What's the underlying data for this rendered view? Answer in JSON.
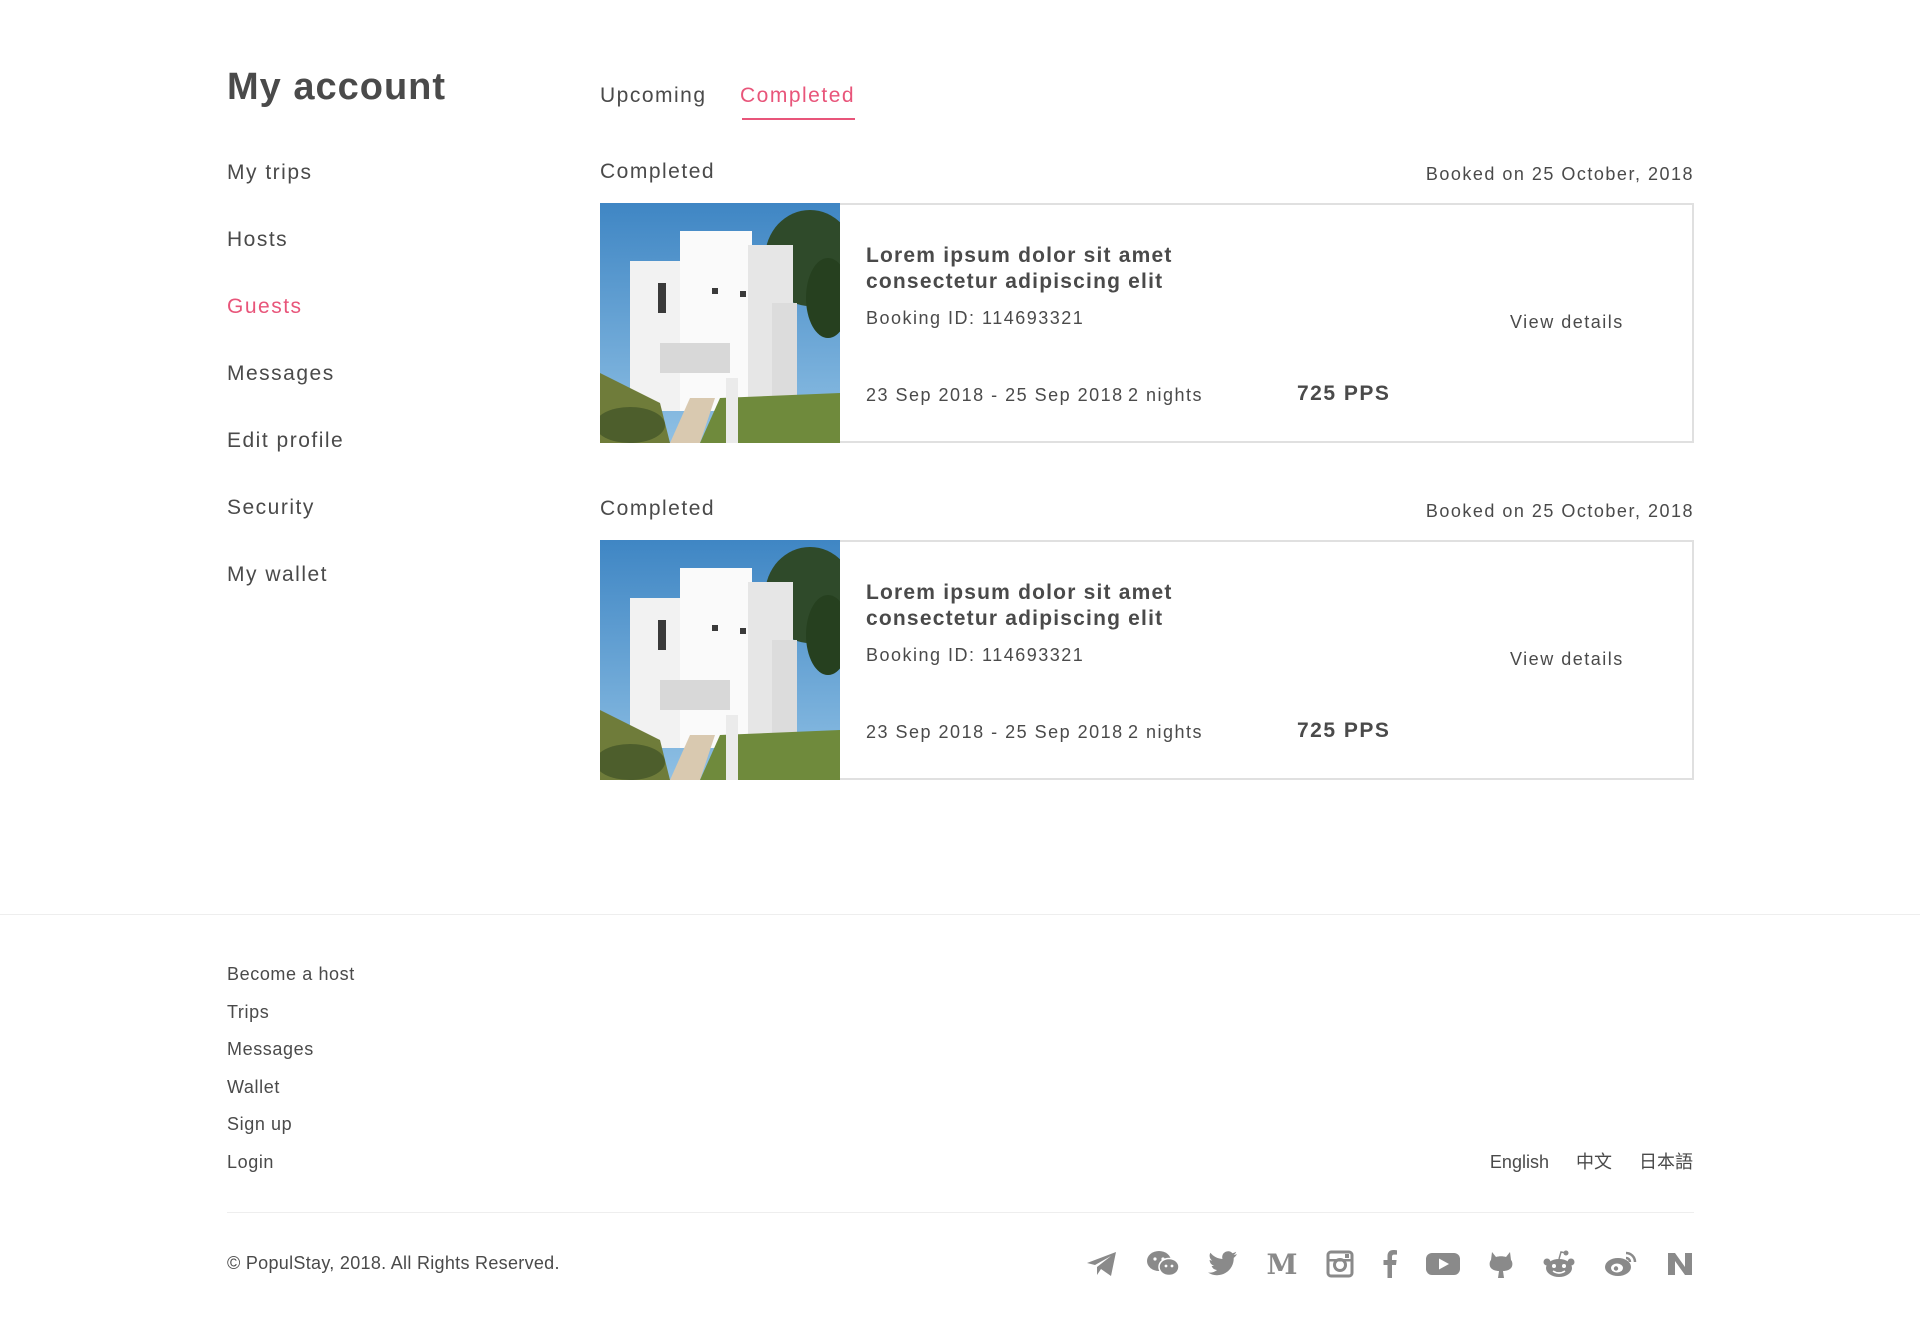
{
  "page": {
    "title": "My account"
  },
  "sidebar": {
    "items": [
      {
        "label": "My trips"
      },
      {
        "label": "Hosts"
      },
      {
        "label": "Guests",
        "active": true
      },
      {
        "label": "Messages"
      },
      {
        "label": "Edit profile"
      },
      {
        "label": "Security"
      },
      {
        "label": "My wallet"
      }
    ]
  },
  "tabs": [
    {
      "label": "Upcoming"
    },
    {
      "label": "Completed",
      "active": true
    }
  ],
  "bookings": [
    {
      "status": "Completed",
      "booked_on": "Booked on 25 October, 2018",
      "title": "Lorem ipsum dolor sit amet consectetur adipiscing elit",
      "booking_id": "Booking ID: 114693321",
      "dates": "23 Sep 2018 - 25 Sep 2018",
      "nights": "2 nights",
      "price": "725 PPS",
      "view_details": "View details"
    },
    {
      "status": "Completed",
      "booked_on": "Booked on 25 October, 2018",
      "title": "Lorem ipsum dolor sit amet consectetur adipiscing elit",
      "booking_id": "Booking ID: 114693321",
      "dates": "23 Sep 2018 - 25 Sep 2018",
      "nights": "2 nights",
      "price": "725 PPS",
      "view_details": "View details"
    }
  ],
  "footer": {
    "links": [
      {
        "label": "Become a host"
      },
      {
        "label": "Trips"
      },
      {
        "label": "Messages"
      },
      {
        "label": "Wallet"
      },
      {
        "label": "Sign up"
      },
      {
        "label": "Login"
      }
    ],
    "languages": [
      "English",
      "中文",
      "日本語"
    ],
    "copyright": "© PopulStay, 2018. All Rights Reserved.",
    "social_icons": [
      "telegram-icon",
      "wechat-icon",
      "twitter-icon",
      "medium-icon",
      "instagram-icon",
      "facebook-icon",
      "youtube-icon",
      "github-icon",
      "reddit-icon",
      "weibo-icon",
      "naver-icon"
    ]
  },
  "colors": {
    "accent": "#e8557a",
    "text": "#4a4a4a",
    "icon": "#8a8a8a",
    "border": "#e0e0e0"
  }
}
